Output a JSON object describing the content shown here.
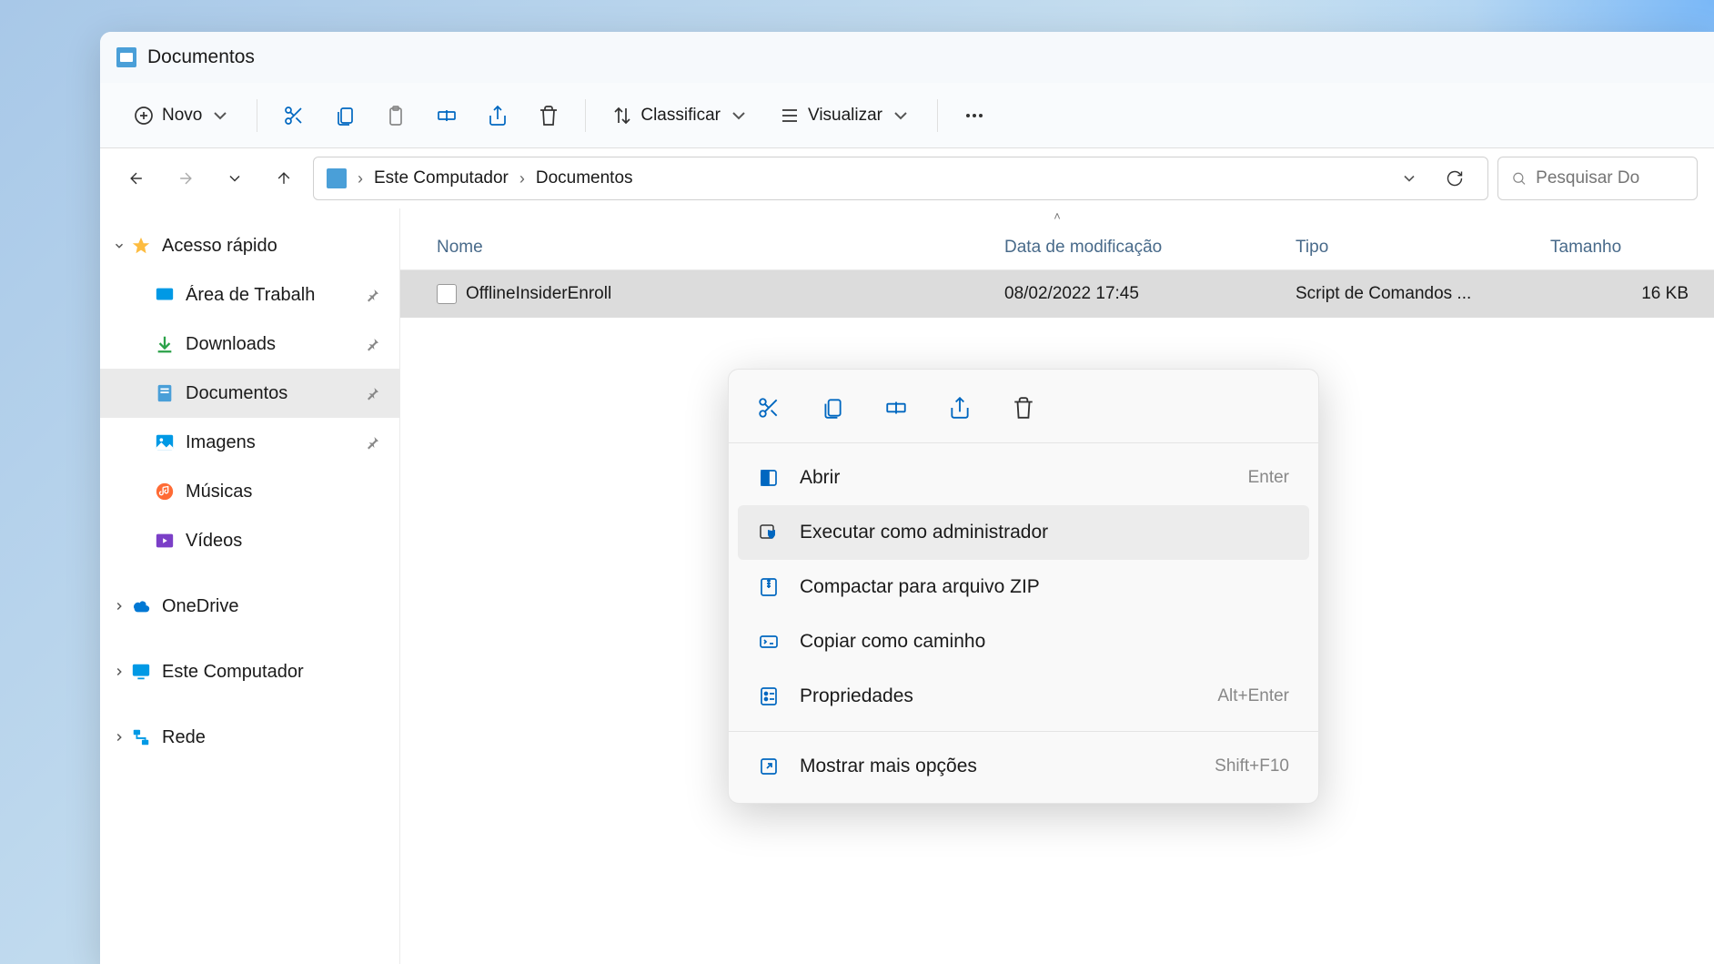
{
  "title": "Documentos",
  "toolbar": {
    "new": "Novo",
    "sort": "Classificar",
    "view": "Visualizar"
  },
  "breadcrumb": {
    "root": "Este Computador",
    "current": "Documentos"
  },
  "search": {
    "placeholder": "Pesquisar Do"
  },
  "sidebar": {
    "quick": "Acesso rápido",
    "desktop": "Área de Trabalh",
    "downloads": "Downloads",
    "documents": "Documentos",
    "images": "Imagens",
    "music": "Músicas",
    "videos": "Vídeos",
    "onedrive": "OneDrive",
    "thispc": "Este Computador",
    "network": "Rede"
  },
  "columns": {
    "name": "Nome",
    "modified": "Data de modificação",
    "type": "Tipo",
    "size": "Tamanho"
  },
  "file": {
    "name": "OfflineInsiderEnroll",
    "modified": "08/02/2022 17:45",
    "type": "Script de Comandos ...",
    "size": "16 KB"
  },
  "context": {
    "open": "Abrir",
    "open_key": "Enter",
    "runas": "Executar como administrador",
    "zip": "Compactar para arquivo ZIP",
    "copypath": "Copiar como caminho",
    "props": "Propriedades",
    "props_key": "Alt+Enter",
    "more": "Mostrar mais opções",
    "more_key": "Shift+F10"
  }
}
